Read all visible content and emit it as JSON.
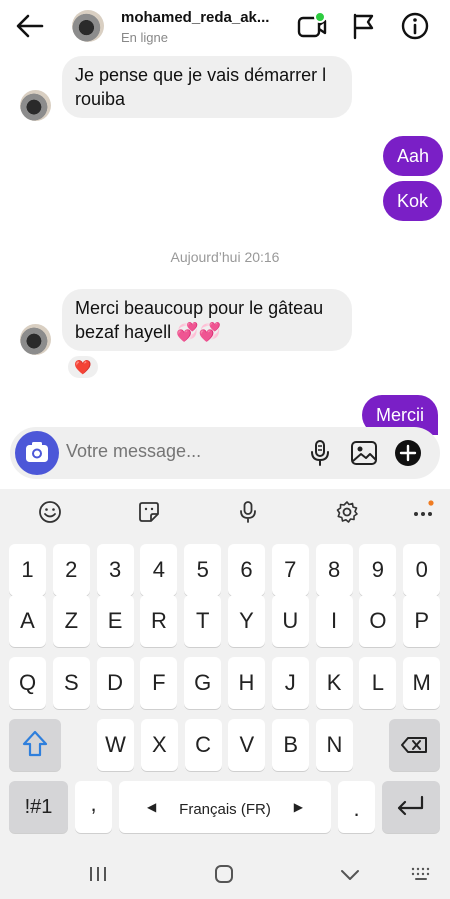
{
  "header": {
    "name": "mohamed_reda_ak...",
    "status": "En ligne",
    "online_color": "#2ecc40"
  },
  "messages": [
    {
      "dir": "in",
      "text": "Je pense que je vais démarrer l rouiba"
    },
    {
      "dir": "out",
      "text": "Aah"
    },
    {
      "dir": "out",
      "text": "Kok"
    },
    {
      "dir": "in",
      "text": "Merci beaucoup pour le gâteau bezaf hayell 💞💞",
      "reaction": "❤️"
    },
    {
      "dir": "out",
      "text": "Mercii"
    }
  ],
  "timestamp": "Aujourd’hui 20:16",
  "composer": {
    "placeholder": "Votre message..."
  },
  "keyboard": {
    "row_numbers": [
      "1",
      "2",
      "3",
      "4",
      "5",
      "6",
      "7",
      "8",
      "9",
      "0"
    ],
    "row1": [
      "A",
      "Z",
      "E",
      "R",
      "T",
      "Y",
      "U",
      "I",
      "O",
      "P"
    ],
    "row2": [
      "Q",
      "S",
      "D",
      "F",
      "G",
      "H",
      "J",
      "K",
      "L",
      "M"
    ],
    "row3": [
      "W",
      "X",
      "C",
      "V",
      "B",
      "N"
    ],
    "symbols_label": "!#1",
    "comma": ",",
    "language": "Français (FR)",
    "period": "."
  },
  "colors": {
    "accent": "#7a1fc6",
    "camera": "#4c57d8",
    "reaction": "#e0245e"
  }
}
